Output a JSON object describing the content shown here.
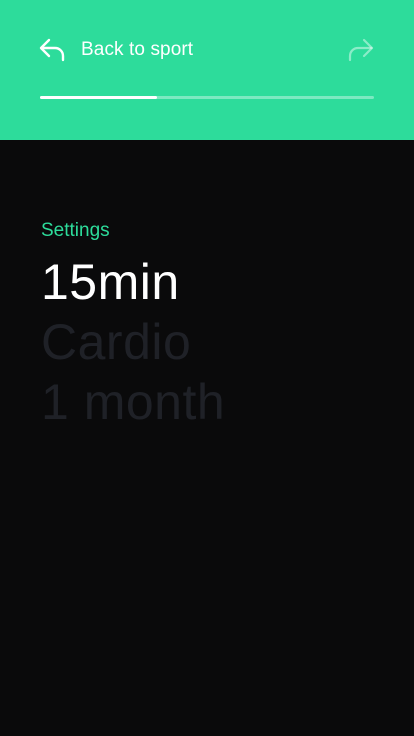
{
  "header": {
    "back_label": "Back to sport",
    "back_icon": "arrow-back-icon",
    "forward_icon": "arrow-forward-icon",
    "progress": 0.35,
    "background_color": "#2ddc9b"
  },
  "settings": {
    "section_label": "Settings",
    "options": [
      {
        "label": "15min",
        "state": "active"
      },
      {
        "label": "Cardio",
        "state": "inactive"
      },
      {
        "label": "1 month",
        "state": "inactive"
      }
    ]
  },
  "colors": {
    "accent": "#2ddc9b",
    "background": "#0a0a0b",
    "active_text": "#ffffff",
    "inactive_text": "#1f2127"
  }
}
